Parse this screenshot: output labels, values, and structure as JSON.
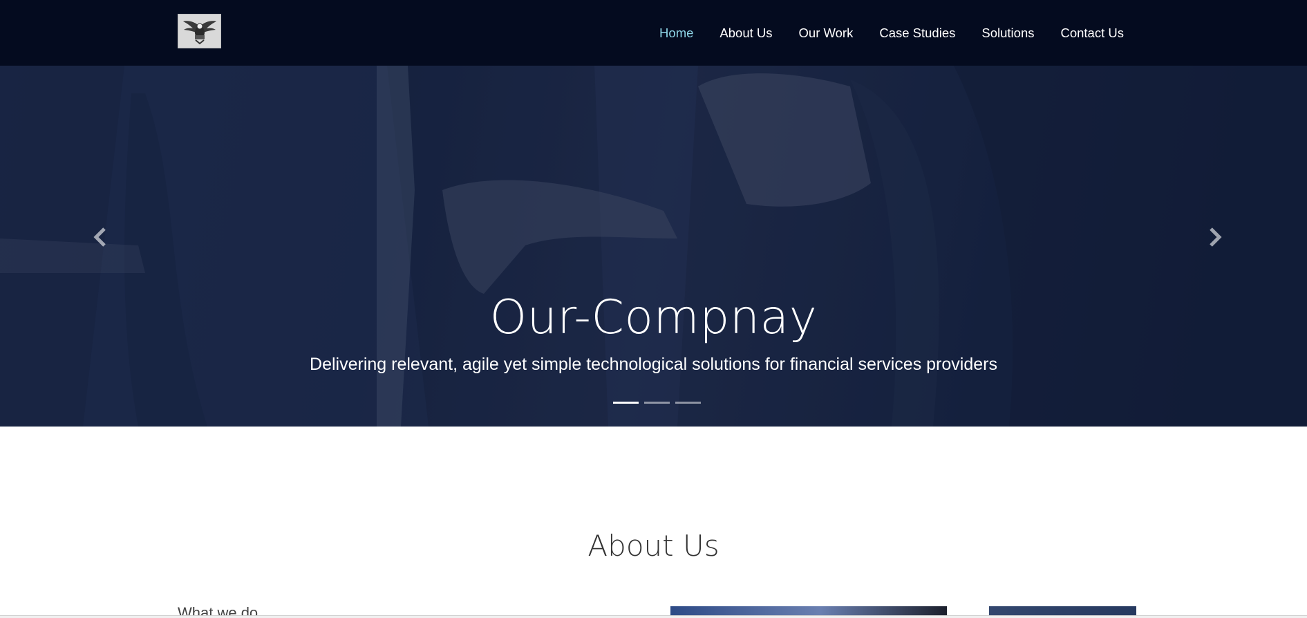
{
  "navbar": {
    "logo_icon": "eagle-emblem-icon",
    "links": [
      {
        "label": "Home",
        "active": true
      },
      {
        "label": "About Us"
      },
      {
        "label": "Our Work"
      },
      {
        "label": "Case Studies"
      },
      {
        "label": "Solutions"
      },
      {
        "label": "Contact Us"
      }
    ],
    "active_color": "#8fd6e8",
    "background": "#040b1f"
  },
  "hero": {
    "title": "Our-Compnay",
    "subtitle": "Delivering relevant, agile yet simple technological solutions for financial services providers",
    "prev_icon": "chevron-left-icon",
    "next_icon": "chevron-right-icon",
    "slide_count": 3,
    "active_slide": 1
  },
  "about": {
    "heading": "About Us",
    "peek_text": "What we do"
  }
}
